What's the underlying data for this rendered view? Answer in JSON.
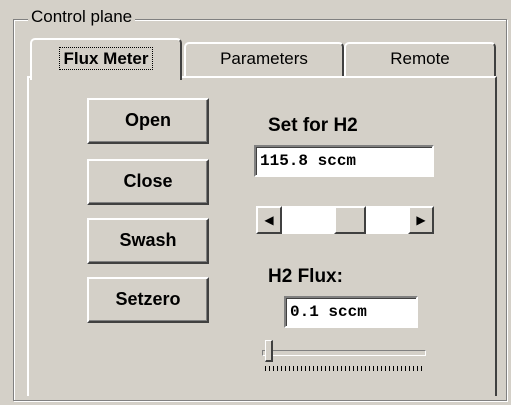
{
  "group": {
    "title": "Control plane"
  },
  "tabs": [
    {
      "label": "Flux Meter",
      "active": true
    },
    {
      "label": "Parameters",
      "active": false
    },
    {
      "label": "Remote",
      "active": false
    }
  ],
  "buttons": {
    "open": "Open",
    "close": "Close",
    "swash": "Swash",
    "setzero": "Setzero"
  },
  "setpoint": {
    "label": "Set for H2",
    "value": "115.8 sccm",
    "scroll_position": 0.55
  },
  "flux": {
    "label": "H2 Flux:",
    "value": "0.1 sccm",
    "slider_position": 0.0
  },
  "icons": {
    "scroll_left": "arrow-left-icon",
    "scroll_right": "arrow-right-icon"
  }
}
